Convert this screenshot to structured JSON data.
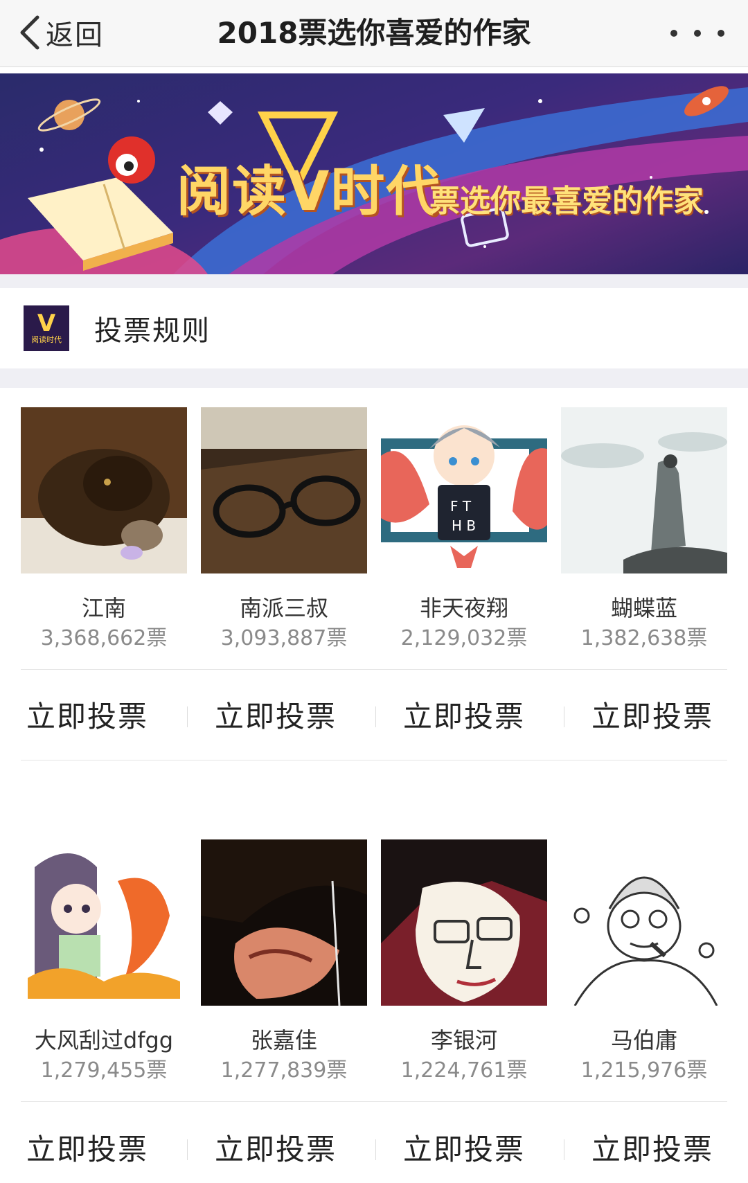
{
  "nav": {
    "back_label": "返回",
    "title": "2018票选你喜爱的作家"
  },
  "banner": {
    "headline": "阅读V时代",
    "subtitle": "票选你最喜爱的作家"
  },
  "rules": {
    "logo_text": "阅读时代",
    "label": "投票规则"
  },
  "vote_label": "立即投票",
  "authors": [
    {
      "name": "江南",
      "votes": "3,368,662票"
    },
    {
      "name": "南派三叔",
      "votes": "3,093,887票"
    },
    {
      "name": "非天夜翔",
      "votes": "2,129,032票"
    },
    {
      "name": "蝴蝶蓝",
      "votes": "1,382,638票"
    },
    {
      "name": "大风刮过dfgg",
      "votes": "1,279,455票"
    },
    {
      "name": "张嘉佳",
      "votes": "1,277,839票"
    },
    {
      "name": "李银河",
      "votes": "1,224,761票"
    },
    {
      "name": "马伯庸",
      "votes": "1,215,976票"
    }
  ]
}
